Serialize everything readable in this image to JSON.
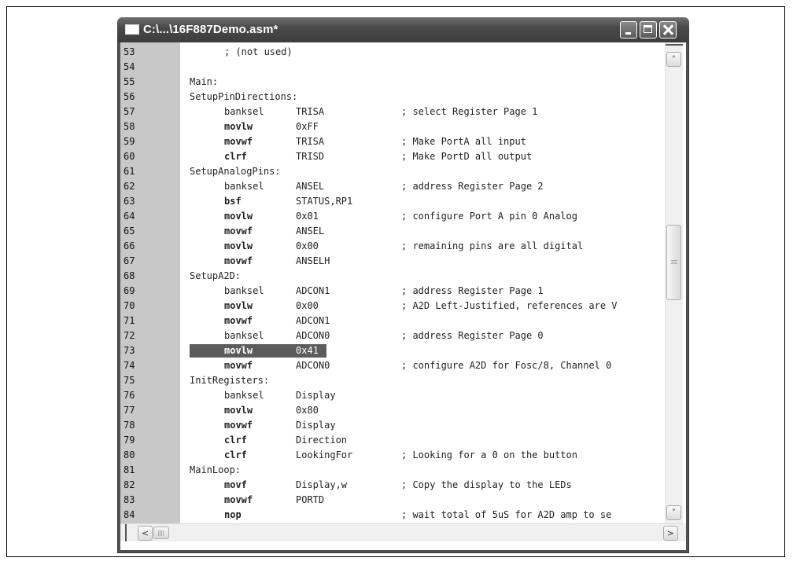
{
  "window": {
    "title": "C:\\...\\16F887Demo.asm*",
    "icon": "document-window-icon"
  },
  "titlebar_buttons": {
    "minimize": "minimize-icon",
    "maximize": "maximize-icon",
    "close": "close-icon"
  },
  "scrollbars": {
    "up_arrow": "˄",
    "down_arrow": "˅",
    "left_arrow": "<",
    "right_arrow": ">"
  },
  "editor": {
    "selected_line": "73",
    "lines": [
      {
        "n": "53",
        "label": "",
        "ins": "; (not used)",
        "op": "",
        "cm": "",
        "bold": false
      },
      {
        "n": "54",
        "label": "",
        "ins": "",
        "op": "",
        "cm": "",
        "bold": false
      },
      {
        "n": "55",
        "label": "Main:",
        "ins": "",
        "op": "",
        "cm": "",
        "bold": false
      },
      {
        "n": "56",
        "label": "SetupPinDirections:",
        "ins": "",
        "op": "",
        "cm": "",
        "bold": false
      },
      {
        "n": "57",
        "label": "",
        "ins": "banksel",
        "op": "TRISA",
        "cm": "; select Register Page 1",
        "bold": false
      },
      {
        "n": "58",
        "label": "",
        "ins": "movlw",
        "op": "0xFF",
        "cm": "",
        "bold": true
      },
      {
        "n": "59",
        "label": "",
        "ins": "movwf",
        "op": "TRISA",
        "cm": "; Make PortA all input",
        "bold": true
      },
      {
        "n": "60",
        "label": "",
        "ins": "clrf",
        "op": "TRISD",
        "cm": "; Make PortD all output",
        "bold": true
      },
      {
        "n": "61",
        "label": "SetupAnalogPins:",
        "ins": "",
        "op": "",
        "cm": "",
        "bold": false
      },
      {
        "n": "62",
        "label": "",
        "ins": "banksel",
        "op": "ANSEL",
        "cm": "; address Register Page 2",
        "bold": false
      },
      {
        "n": "63",
        "label": "",
        "ins": "bsf",
        "op": "STATUS,RP1",
        "cm": "",
        "bold": true
      },
      {
        "n": "64",
        "label": "",
        "ins": "movlw",
        "op": "0x01",
        "cm": "; configure Port A pin 0 Analog",
        "bold": true
      },
      {
        "n": "65",
        "label": "",
        "ins": "movwf",
        "op": "ANSEL",
        "cm": "",
        "bold": true
      },
      {
        "n": "66",
        "label": "",
        "ins": "movlw",
        "op": "0x00",
        "cm": "; remaining pins are all digital",
        "bold": true
      },
      {
        "n": "67",
        "label": "",
        "ins": "movwf",
        "op": "ANSELH",
        "cm": "",
        "bold": true
      },
      {
        "n": "68",
        "label": "SetupA2D:",
        "ins": "",
        "op": "",
        "cm": "",
        "bold": false
      },
      {
        "n": "69",
        "label": "",
        "ins": "banksel",
        "op": "ADCON1",
        "cm": "; address Register Page 1",
        "bold": false
      },
      {
        "n": "70",
        "label": "",
        "ins": "movlw",
        "op": "0x00",
        "cm": "; A2D Left-Justified, references are V",
        "bold": true
      },
      {
        "n": "71",
        "label": "",
        "ins": "movwf",
        "op": "ADCON1",
        "cm": "",
        "bold": true
      },
      {
        "n": "72",
        "label": "",
        "ins": "banksel",
        "op": "ADCON0",
        "cm": "; address Register Page 0",
        "bold": false
      },
      {
        "n": "73",
        "label": "",
        "ins": "movlw",
        "op": "0x41",
        "cm": "",
        "bold": true
      },
      {
        "n": "74",
        "label": "",
        "ins": "movwf",
        "op": "ADCON0",
        "cm": "; configure A2D for Fosc/8, Channel 0",
        "bold": true
      },
      {
        "n": "75",
        "label": "InitRegisters:",
        "ins": "",
        "op": "",
        "cm": "",
        "bold": false
      },
      {
        "n": "76",
        "label": "",
        "ins": "banksel",
        "op": "Display",
        "cm": "",
        "bold": false
      },
      {
        "n": "77",
        "label": "",
        "ins": "movlw",
        "op": "0x80",
        "cm": "",
        "bold": true
      },
      {
        "n": "78",
        "label": "",
        "ins": "movwf",
        "op": "Display",
        "cm": "",
        "bold": true
      },
      {
        "n": "79",
        "label": "",
        "ins": "clrf",
        "op": "Direction",
        "cm": "",
        "bold": true
      },
      {
        "n": "80",
        "label": "",
        "ins": "clrf",
        "op": "LookingFor",
        "cm": "; Looking for a 0 on the button",
        "bold": true
      },
      {
        "n": "81",
        "label": "MainLoop:",
        "ins": "",
        "op": "",
        "cm": "",
        "bold": false
      },
      {
        "n": "82",
        "label": "",
        "ins": "movf",
        "op": "Display,w",
        "cm": "; Copy the display to the LEDs",
        "bold": true
      },
      {
        "n": "83",
        "label": "",
        "ins": "movwf",
        "op": "PORTD",
        "cm": "",
        "bold": true
      },
      {
        "n": "84",
        "label": "",
        "ins": "nop",
        "op": "",
        "cm": "; wait total of 5uS for A2D amp to se",
        "bold": true
      }
    ]
  }
}
